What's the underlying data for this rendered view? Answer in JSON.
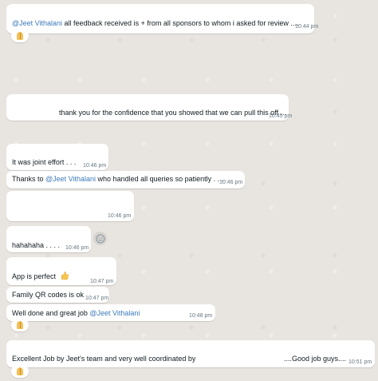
{
  "messages": [
    {
      "mention": "@Jeet Vithalani",
      "text": " all feedback received is + from all sponsors to whom i asked for review ....",
      "time": "10:44 pm",
      "reaction": "folded-hands"
    },
    {
      "text": "thank you for the confidence that you showed that we can pull this off ...",
      "time": "10:45 pm"
    },
    {
      "text": "It was joint effort . . .",
      "time": "10:46 pm"
    },
    {
      "text_before": "Thanks to ",
      "mention": "@Jeet Vithalani",
      "text_after": " who handled all queries so patiently . . .",
      "time": "10:46 pm"
    },
    {
      "text": "",
      "time": "10:46 pm"
    },
    {
      "text": "hahahaha . . . .",
      "time": "10:46 pm"
    },
    {
      "text": "App is perfect",
      "emoji": "thumbs-up",
      "time": "10:47 pm"
    },
    {
      "text": "Family QR codes is ok",
      "time": "10:47 pm"
    },
    {
      "text_before": "Well done and great job ",
      "mention": "@Jeet Vithalani",
      "time": "10:48 pm",
      "reaction": "folded-hands"
    },
    {
      "text_left": "Excellent Job by Jeet's team and very well coordinated by",
      "text_right": "....Good job guys....",
      "time": "10:51 pm",
      "reaction": "folded-hands"
    }
  ],
  "icons": {
    "reaction_button": "smiley-icon",
    "reaction": "folded-hands-icon",
    "emoji": "thumbs-up-icon"
  },
  "colors": {
    "mention": "#3d7bb9",
    "bubble": "#ffffff",
    "background": "#e8e4df",
    "time": "#667781"
  }
}
